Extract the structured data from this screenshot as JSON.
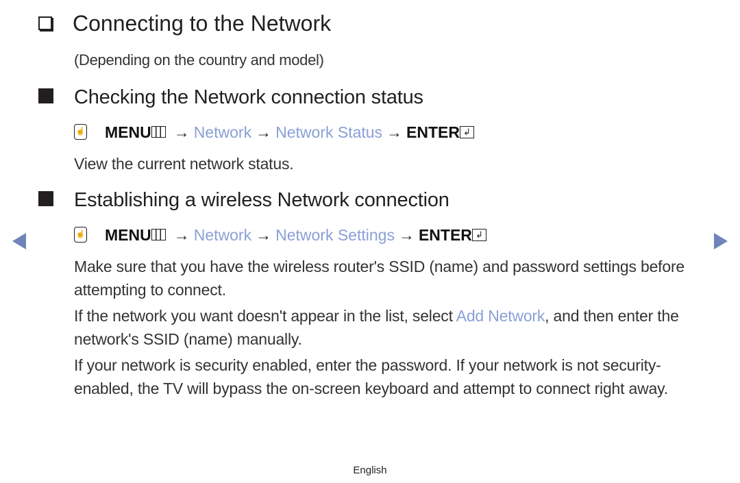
{
  "title": "Connecting to the Network",
  "subtitle": "(Depending on the country and model)",
  "sections": [
    {
      "heading": "Checking the Network connection status",
      "path": {
        "menu": "MENU",
        "arrow": "→",
        "steps": [
          "Network",
          "Network Status"
        ],
        "enter": "ENTER"
      },
      "paragraphs": [
        "View the current network status."
      ]
    },
    {
      "heading": "Establishing a wireless Network connection",
      "path": {
        "menu": "MENU",
        "arrow": "→",
        "steps": [
          "Network",
          "Network Settings"
        ],
        "enter": "ENTER"
      },
      "paragraphs": [
        "Make sure that you have the wireless router's SSID (name) and password settings before attempting to connect.",
        {
          "before": "If the network you want doesn't appear in the list, select ",
          "link": "Add Network",
          "after": ", and then enter the network's SSID (name) manually."
        },
        "If your network is security enabled, enter the password. If your network is not security-enabled, the TV will bypass the on-screen keyboard and attempt to connect right away."
      ]
    }
  ],
  "navigation": {
    "prev": "previous-page",
    "next": "next-page"
  },
  "footer": {
    "language": "English"
  },
  "colors": {
    "link": "#8a9fd6",
    "nav_arrow": "#6f84b8",
    "text": "#231f20"
  }
}
